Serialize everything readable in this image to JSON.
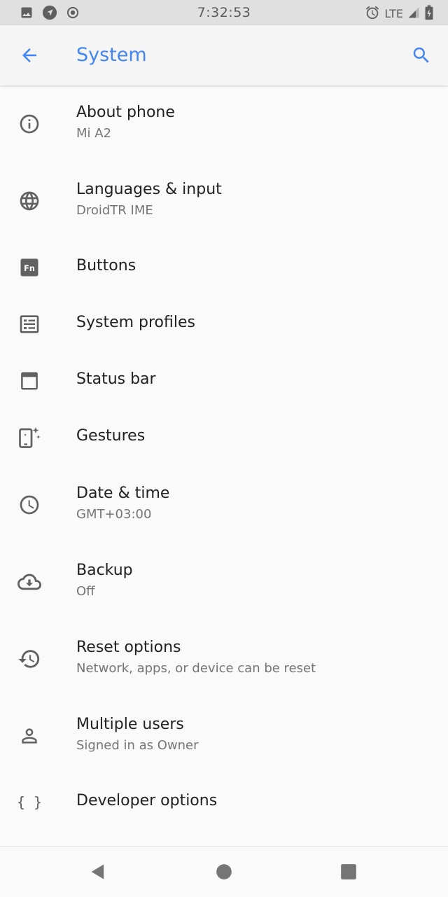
{
  "status_bar": {
    "time": "7:32:53",
    "network": "LTE",
    "left_icons": [
      "image-icon",
      "navigation-icon",
      "record-icon"
    ],
    "right_icons": [
      "alarm-icon",
      "lte-signal-icon",
      "battery-charging-icon"
    ]
  },
  "app_bar": {
    "title": "System",
    "back_icon": "arrow-back-icon",
    "search_icon": "search-icon",
    "accent_color": "#4285f4"
  },
  "settings": [
    {
      "icon": "info-icon",
      "title": "About phone",
      "summary": "Mi A2"
    },
    {
      "icon": "globe-icon",
      "title": "Languages & input",
      "summary": "DroidTR IME"
    },
    {
      "icon": "fn-key-icon",
      "title": "Buttons",
      "summary": ""
    },
    {
      "icon": "profiles-icon",
      "title": "System profiles",
      "summary": ""
    },
    {
      "icon": "status-bar-icon",
      "title": "Status bar",
      "summary": ""
    },
    {
      "icon": "gestures-icon",
      "title": "Gestures",
      "summary": ""
    },
    {
      "icon": "clock-icon",
      "title": "Date & time",
      "summary": "GMT+03:00"
    },
    {
      "icon": "cloud-backup-icon",
      "title": "Backup",
      "summary": "Off"
    },
    {
      "icon": "reset-history-icon",
      "title": "Reset options",
      "summary": "Network, apps, or device can be reset"
    },
    {
      "icon": "person-icon",
      "title": "Multiple users",
      "summary": "Signed in as Owner"
    },
    {
      "icon": "braces-icon",
      "title": "Developer options",
      "summary": ""
    }
  ],
  "nav_bar": {
    "buttons": [
      "nav-back-icon",
      "nav-home-icon",
      "nav-recents-icon"
    ]
  },
  "colors": {
    "icon_gray": "#616161",
    "title_text": "#212121",
    "summary_text": "#757575",
    "background": "#fafafa"
  }
}
